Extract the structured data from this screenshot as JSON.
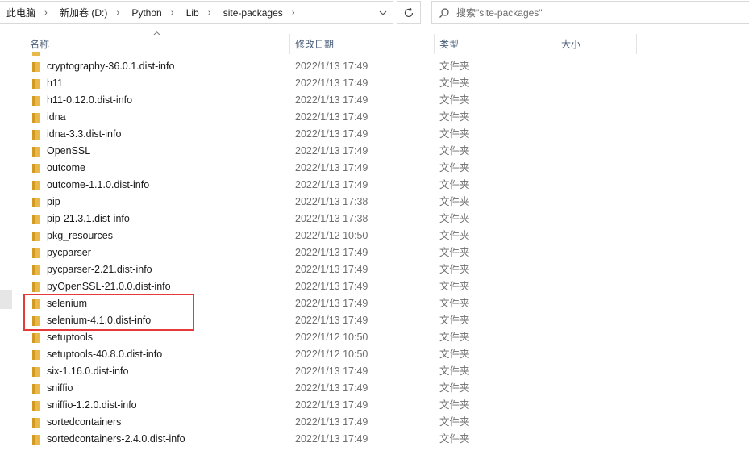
{
  "address_bar": {
    "breadcrumbs": [
      "此电脑",
      "新加卷 (D:)",
      "Python",
      "Lib",
      "site-packages"
    ],
    "dropdown_icon": "chevron-down-icon",
    "refresh_icon": "refresh-icon"
  },
  "search": {
    "placeholder": "搜索\"site-packages\"",
    "icon": "search-icon"
  },
  "columns": {
    "name": "名称",
    "date": "修改日期",
    "type": "类型",
    "size": "大小"
  },
  "files": [
    {
      "name": "cryptography-36.0.1.dist-info",
      "date": "2022/1/13 17:49",
      "type": "文件夹"
    },
    {
      "name": "h11",
      "date": "2022/1/13 17:49",
      "type": "文件夹"
    },
    {
      "name": "h11-0.12.0.dist-info",
      "date": "2022/1/13 17:49",
      "type": "文件夹"
    },
    {
      "name": "idna",
      "date": "2022/1/13 17:49",
      "type": "文件夹"
    },
    {
      "name": "idna-3.3.dist-info",
      "date": "2022/1/13 17:49",
      "type": "文件夹"
    },
    {
      "name": "OpenSSL",
      "date": "2022/1/13 17:49",
      "type": "文件夹"
    },
    {
      "name": "outcome",
      "date": "2022/1/13 17:49",
      "type": "文件夹"
    },
    {
      "name": "outcome-1.1.0.dist-info",
      "date": "2022/1/13 17:49",
      "type": "文件夹"
    },
    {
      "name": "pip",
      "date": "2022/1/13 17:38",
      "type": "文件夹"
    },
    {
      "name": "pip-21.3.1.dist-info",
      "date": "2022/1/13 17:38",
      "type": "文件夹"
    },
    {
      "name": "pkg_resources",
      "date": "2022/1/12 10:50",
      "type": "文件夹"
    },
    {
      "name": "pycparser",
      "date": "2022/1/13 17:49",
      "type": "文件夹"
    },
    {
      "name": "pycparser-2.21.dist-info",
      "date": "2022/1/13 17:49",
      "type": "文件夹"
    },
    {
      "name": "pyOpenSSL-21.0.0.dist-info",
      "date": "2022/1/13 17:49",
      "type": "文件夹"
    },
    {
      "name": "selenium",
      "date": "2022/1/13 17:49",
      "type": "文件夹"
    },
    {
      "name": "selenium-4.1.0.dist-info",
      "date": "2022/1/13 17:49",
      "type": "文件夹"
    },
    {
      "name": "setuptools",
      "date": "2022/1/12 10:50",
      "type": "文件夹"
    },
    {
      "name": "setuptools-40.8.0.dist-info",
      "date": "2022/1/12 10:50",
      "type": "文件夹"
    },
    {
      "name": "six-1.16.0.dist-info",
      "date": "2022/1/13 17:49",
      "type": "文件夹"
    },
    {
      "name": "sniffio",
      "date": "2022/1/13 17:49",
      "type": "文件夹"
    },
    {
      "name": "sniffio-1.2.0.dist-info",
      "date": "2022/1/13 17:49",
      "type": "文件夹"
    },
    {
      "name": "sortedcontainers",
      "date": "2022/1/13 17:49",
      "type": "文件夹"
    },
    {
      "name": "sortedcontainers-2.4.0.dist-info",
      "date": "2022/1/13 17:49",
      "type": "文件夹"
    }
  ],
  "colors": {
    "folder_yellow": "#e8b84a",
    "folder_dark": "#d29a22",
    "highlight_red": "#e5393a",
    "header_text": "#4c607a"
  }
}
